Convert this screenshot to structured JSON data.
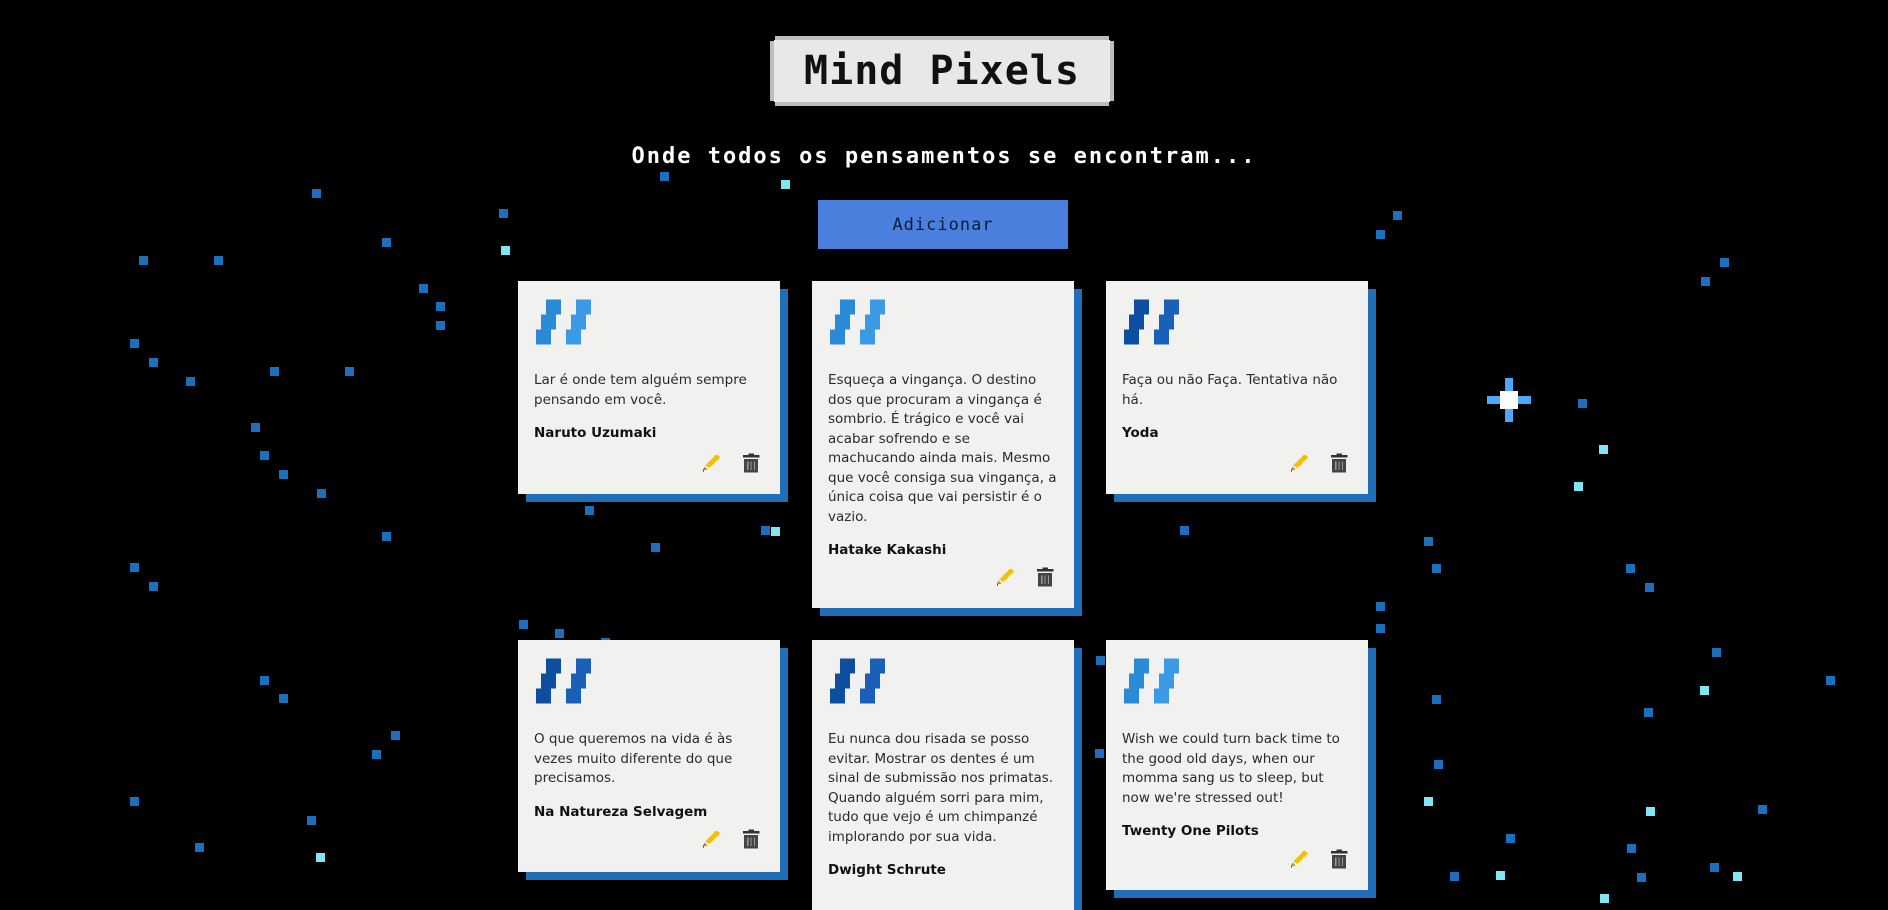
{
  "header": {
    "title": "Mind Pixels",
    "subtitle": "Onde todos os pensamentos se encontram...",
    "add_label": "Adicionar"
  },
  "colors": {
    "background": "#000000",
    "button": "#4a7fdd",
    "card": "#f1f2f0",
    "card_shadow": "#1f6fb8",
    "quote_light": "#2a8ad8",
    "quote_dark": "#0e4ea0"
  },
  "cards": [
    {
      "text": "Lar é onde tem alguém sempre pensando em você.",
      "author": "Naruto Uzumaki",
      "quote_color": "light"
    },
    {
      "text": "Esqueça a vingança. O destino dos que procuram a vingança é sombrio. É trágico e você vai acabar sofrendo e se machucando ainda mais. Mesmo que você consiga sua vingança, a única coisa que vai persistir é o vazio.",
      "author": "Hatake Kakashi",
      "quote_color": "light"
    },
    {
      "text": "Faça ou não Faça. Tentativa não há.",
      "author": "Yoda",
      "quote_color": "dark"
    },
    {
      "text": "O que queremos na vida é às vezes muito diferente do que precisamos.",
      "author": "Na Natureza Selvagem",
      "quote_color": "dark"
    },
    {
      "text": "Eu nunca dou risada se posso evitar. Mostrar os dentes é um sinal de submissão nos primatas. Quando alguém sorri para mim, tudo que vejo é um chimpanzé implorando por sua vida.",
      "author": "Dwight Schrute",
      "quote_color": "dark"
    },
    {
      "text": "Wish we could turn back time to the good old days, when our momma sang us to sleep, but now we're stressed out!",
      "author": "Twenty One Pilots",
      "quote_color": "light"
    }
  ],
  "icons": {
    "edit": "pencil-icon",
    "delete": "trash-icon",
    "quote": "quote-icon"
  }
}
